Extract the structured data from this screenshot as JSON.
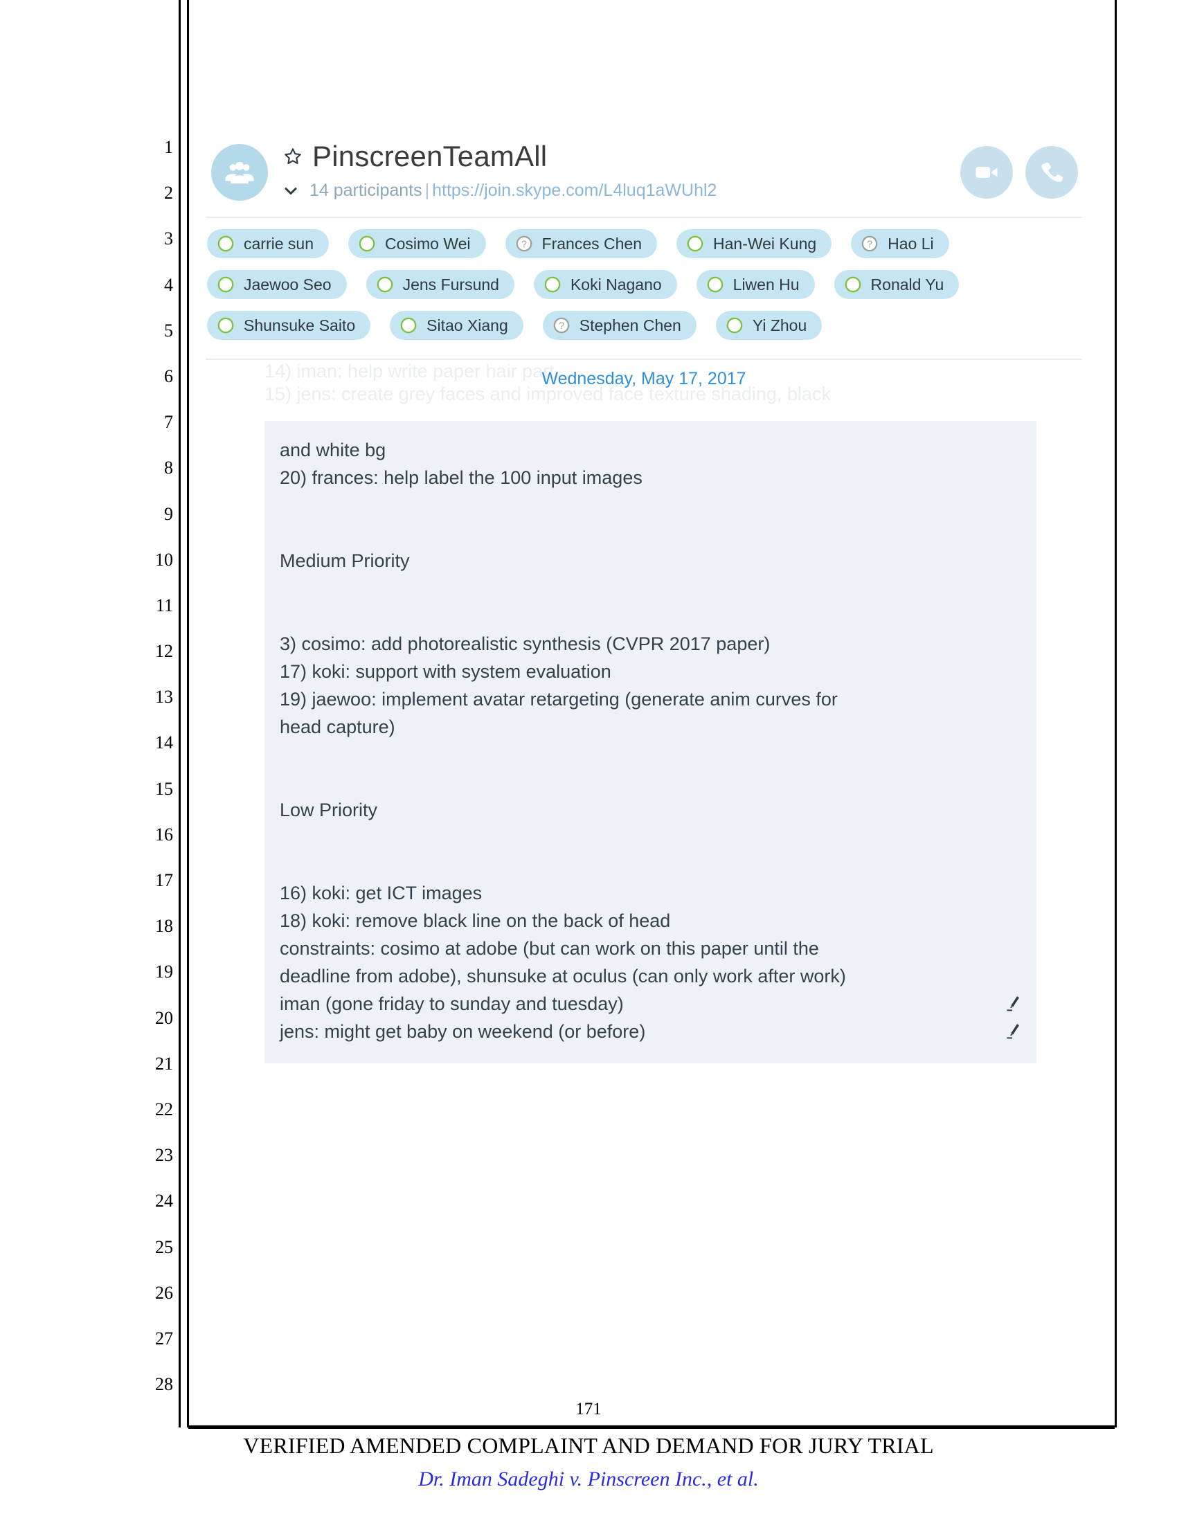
{
  "pleading": {
    "line_numbers": [
      "1",
      "2",
      "3",
      "4",
      "5",
      "6",
      "7",
      "8",
      "9",
      "10",
      "11",
      "12",
      "13",
      "14",
      "15",
      "16",
      "17",
      "18",
      "19",
      "20",
      "21",
      "22",
      "23",
      "24",
      "25",
      "26",
      "27",
      "28"
    ],
    "page_number": "171",
    "footer_title": "VERIFIED AMENDED COMPLAINT AND DEMAND FOR JURY TRIAL",
    "footer_case": "Dr. Iman Sadeghi v. Pinscreen Inc., et al."
  },
  "chat": {
    "header": {
      "avatar_icon": "group-people-icon",
      "favorite_icon": "star-icon",
      "title": "PinscreenTeamAll",
      "expand_icon": "chevron-down-icon",
      "participants_count": "14 participants",
      "separator": "|",
      "join_url": "https://join.skype.com/L4luq1aWUhl2",
      "video_call_label": "video-call",
      "video_call_icon": "video-camera-icon",
      "audio_call_label": "audio-call",
      "audio_call_icon": "phone-icon"
    },
    "participants": [
      [
        {
          "name": "carrie sun",
          "status": "online",
          "status_icon": "circle-online-icon"
        },
        {
          "name": "Cosimo Wei",
          "status": "online",
          "status_icon": "circle-online-icon"
        },
        {
          "name": "Frances Chen",
          "status": "unknown",
          "status_icon": "question-mark-icon"
        },
        {
          "name": "Han-Wei Kung",
          "status": "online",
          "status_icon": "circle-online-icon"
        },
        {
          "name": "Hao Li",
          "status": "unknown",
          "status_icon": "question-mark-icon"
        }
      ],
      [
        {
          "name": "Jaewoo Seo",
          "status": "online",
          "status_icon": "circle-online-icon"
        },
        {
          "name": "Jens Fursund",
          "status": "online",
          "status_icon": "circle-online-icon"
        },
        {
          "name": "Koki Nagano",
          "status": "online",
          "status_icon": "circle-online-icon"
        },
        {
          "name": "Liwen Hu",
          "status": "online",
          "status_icon": "circle-online-icon"
        },
        {
          "name": "Ronald Yu",
          "status": "online",
          "status_icon": "circle-online-icon"
        }
      ],
      [
        {
          "name": "Shunsuke Saito",
          "status": "online",
          "status_icon": "circle-online-icon"
        },
        {
          "name": "Sitao Xiang",
          "status": "online",
          "status_icon": "circle-online-icon"
        },
        {
          "name": "Stephen Chen",
          "status": "unknown",
          "status_icon": "question-mark-icon"
        },
        {
          "name": "Yi Zhou",
          "status": "online",
          "status_icon": "circle-online-icon"
        }
      ]
    ],
    "faded_lines": [
      "14) iman: help write paper hair part",
      "15) jens: create grey faces and improved face texture shading, black"
    ],
    "date_divider": "Wednesday, May 17, 2017",
    "message_lines": [
      {
        "text": "and white bg",
        "edited": false
      },
      {
        "text": "20) frances: help label the 100 input images",
        "edited": false
      },
      {
        "text": "",
        "edited": false
      },
      {
        "text": "",
        "edited": false
      },
      {
        "text": "Medium Priority",
        "edited": false
      },
      {
        "text": "",
        "edited": false
      },
      {
        "text": "",
        "edited": false
      },
      {
        "text": "3) cosimo: add photorealistic synthesis (CVPR 2017 paper)",
        "edited": false
      },
      {
        "text": "17) koki: support with system evaluation",
        "edited": false
      },
      {
        "text": "19) jaewoo: implement avatar retargeting (generate anim curves for",
        "edited": false
      },
      {
        "text": "head capture)",
        "edited": false
      },
      {
        "text": "",
        "edited": false
      },
      {
        "text": "",
        "edited": false
      },
      {
        "text": "Low Priority",
        "edited": false
      },
      {
        "text": "",
        "edited": false
      },
      {
        "text": "",
        "edited": false
      },
      {
        "text": "16) koki: get ICT images",
        "edited": false
      },
      {
        "text": "18) koki: remove black line on the back of head",
        "edited": false
      },
      {
        "text": "constraints: cosimo at adobe (but can work on this paper until the",
        "edited": false
      },
      {
        "text": "deadline from adobe), shunsuke at oculus (can only work after work)",
        "edited": false
      },
      {
        "text": "iman (gone friday to sunday and tuesday)",
        "edited": true
      },
      {
        "text": "jens: might get baby on weekend (or before)",
        "edited": true
      }
    ],
    "colors": {
      "chip_bg": "#c6e5f2",
      "avatar_bg": "#b4d9e8",
      "action_bg": "#c7e0ec",
      "bubble_bg": "#eef2f7",
      "date_text": "#2f8fd8",
      "url_text": "#8bb6d8",
      "status_online": "#7cc242",
      "status_unknown": "#a0a0a0"
    }
  }
}
